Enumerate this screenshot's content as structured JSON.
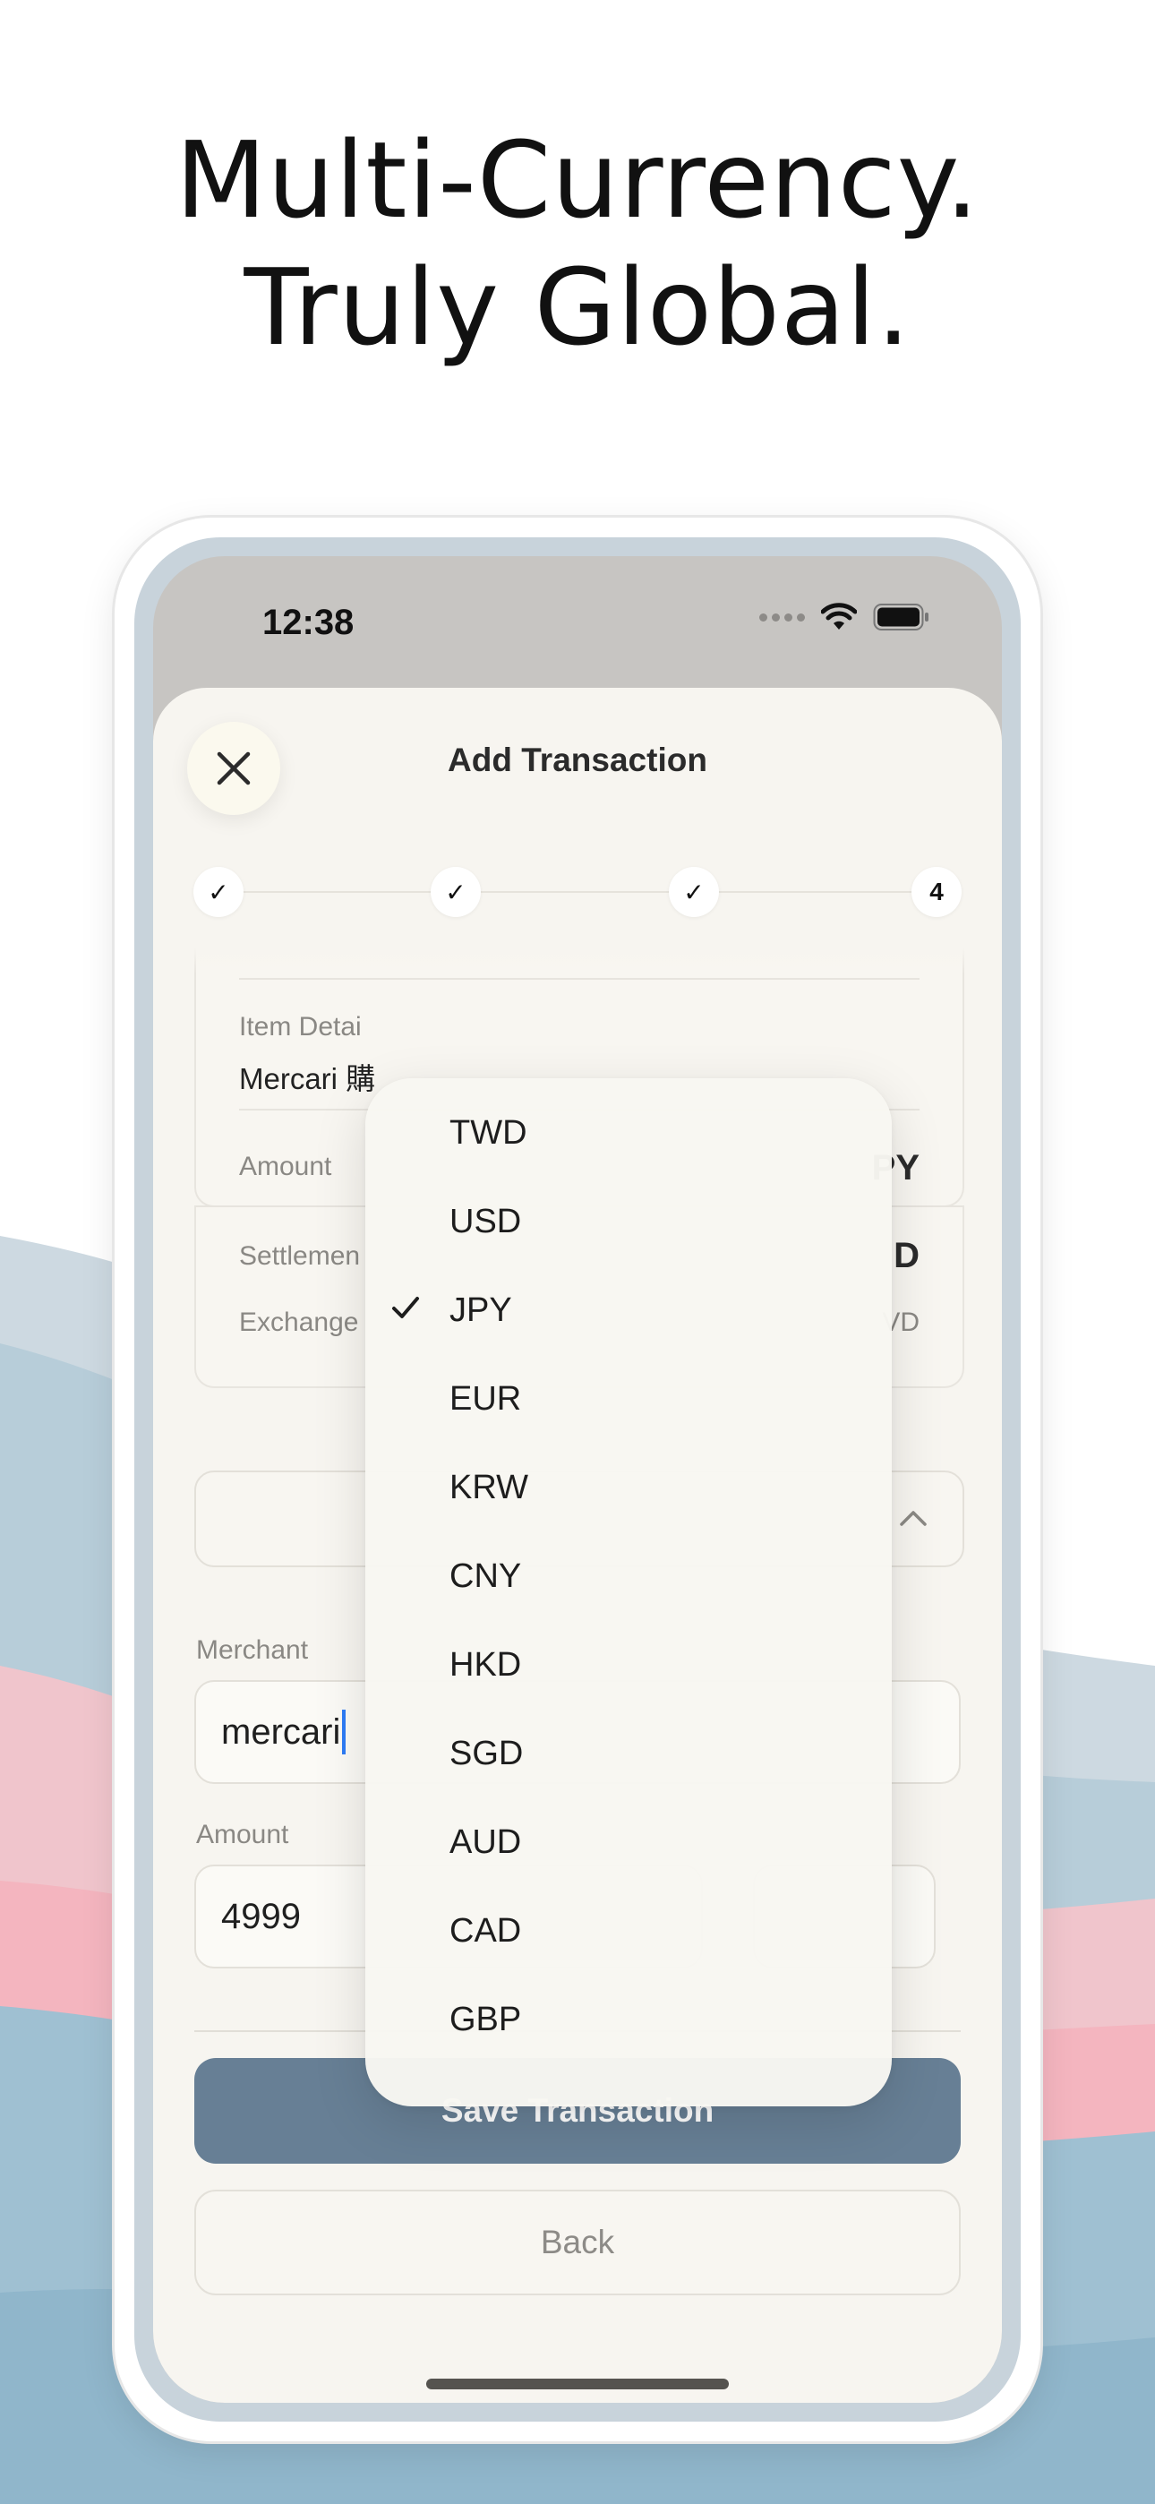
{
  "headline": {
    "line1": "Multi-Currency.",
    "line2": "Truly Global."
  },
  "status_bar": {
    "time": "12:38"
  },
  "sheet": {
    "title": "Add Transaction"
  },
  "stepper": {
    "steps": [
      "✓",
      "✓",
      "✓",
      "4"
    ],
    "current_step": 4
  },
  "details_card": {
    "item_details_label": "Item Detai",
    "item_details_value": "Mercari 購",
    "amount_label": "Amount",
    "amount_value_suffix": "PY",
    "settlement_label": "Settlemen",
    "settlement_value_suffix": "D",
    "exchange_label": "Exchange",
    "exchange_value_suffix": "VD"
  },
  "form": {
    "merchant_label": "Merchant",
    "merchant_value": "mercari",
    "amount_label": "Amount",
    "amount_value": "4999"
  },
  "currency_dropdown": {
    "selected": "JPY",
    "options": [
      "TWD",
      "USD",
      "JPY",
      "EUR",
      "KRW",
      "CNY",
      "HKD",
      "SGD",
      "AUD",
      "CAD",
      "GBP"
    ]
  },
  "buttons": {
    "save": "Save Transaction",
    "back": "Back"
  },
  "colors": {
    "save_button": "#677f95",
    "sheet_background": "#f7f5f0",
    "caret": "#2e7cf6",
    "wave_blue": "#a7c3d2",
    "wave_pink": "#f2b9c2"
  },
  "icons": {
    "close": "close-icon",
    "wifi": "wifi-icon",
    "battery": "battery-icon",
    "signal": "signal-dots-icon",
    "chevron": "chevron-up-icon",
    "check": "checkmark-icon"
  }
}
